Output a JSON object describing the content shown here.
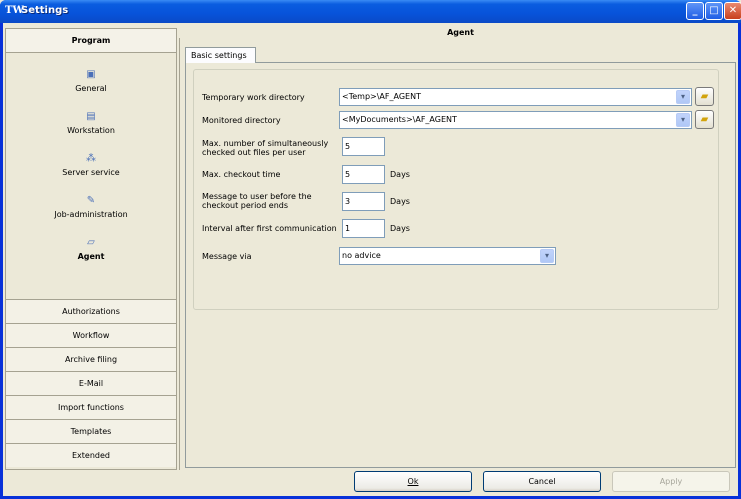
{
  "window": {
    "title": "Settings",
    "icon_label": "TW"
  },
  "nav": {
    "header": "Program",
    "items": [
      {
        "label": "General",
        "icon": "general-icon"
      },
      {
        "label": "Workstation",
        "icon": "workstation-icon"
      },
      {
        "label": "Server service",
        "icon": "server-service-icon"
      },
      {
        "label": "Job-administration",
        "icon": "job-administration-icon"
      },
      {
        "label": "Agent",
        "icon": "agent-icon",
        "active": true
      }
    ],
    "sections": [
      "Authorizations",
      "Workflow",
      "Archive filing",
      "E-Mail",
      "Import functions",
      "Templates",
      "Extended"
    ]
  },
  "panel": {
    "title": "Agent",
    "tab": "Basic settings"
  },
  "form": {
    "temp_dir_label": "Temporary work directory",
    "temp_dir_value": "<Temp>\\AF_AGENT",
    "monitored_dir_label": "Monitored directory",
    "monitored_dir_value": "<MyDocuments>\\AF_AGENT",
    "max_files_label_1": "Max. number of simultaneously",
    "max_files_label_2": "checked out files per user",
    "max_files_value": "5",
    "max_checkout_label": "Max. checkout time",
    "max_checkout_value": "5",
    "message_before_label_1": "Message to user before the",
    "message_before_label_2": "checkout period ends",
    "message_before_value": "3",
    "interval_label": "Interval after first communication",
    "interval_value": "1",
    "days_unit": "Days",
    "message_via_label": "Message via",
    "message_via_value": "no advice"
  },
  "buttons": {
    "ok": "Ok",
    "cancel": "Cancel",
    "apply": "Apply"
  }
}
